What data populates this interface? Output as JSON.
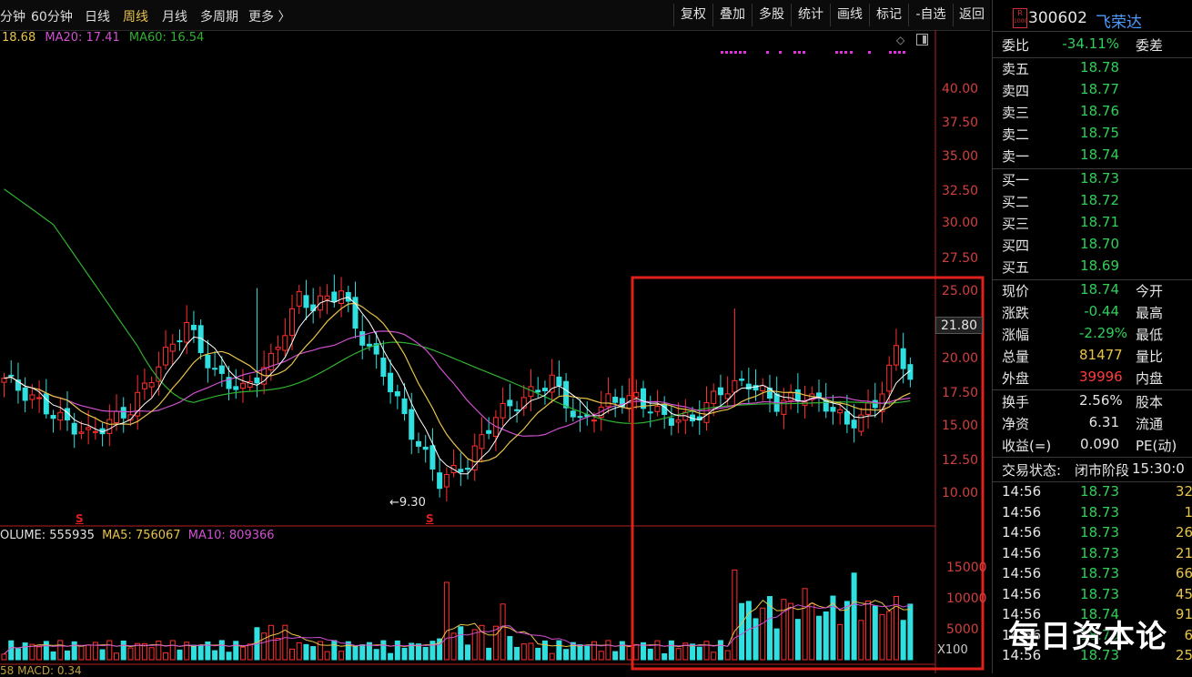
{
  "topbar": {
    "tabs": [
      "分钟",
      "60分钟",
      "日线",
      "周线",
      "月线",
      "多周期",
      "更多 〉"
    ],
    "active_tab": "周线",
    "tools": [
      "复权",
      "叠加",
      "多股",
      "统计",
      "画线",
      "标记",
      "-自选",
      "返回"
    ]
  },
  "ma_legend": {
    "ma10": "18.68",
    "ma20": "MA20: 17.41",
    "ma60": "MA60: 16.54",
    "colors": {
      "ma5": "#ffffff",
      "ma10": "#e8c34a",
      "ma20": "#d050d0",
      "ma60": "#30b030"
    }
  },
  "price_axis": [
    "40.00",
    "37.50",
    "35.00",
    "32.50",
    "30.00",
    "27.50",
    "25.00",
    "22.50",
    "20.00",
    "17.50",
    "15.00",
    "12.50",
    "10.00"
  ],
  "current_price_marker": "21.80",
  "low_marker": "←9.30",
  "s_markers": [
    "S",
    "S"
  ],
  "volume_legend": {
    "volume": "OLUME: 555935",
    "ma5": "MA5: 756067",
    "ma10": "MA10: 809366"
  },
  "volume_axis": [
    "15000",
    "10000",
    "5000"
  ],
  "volume_unit": "X100",
  "macd_legend": "58  MACD: 0.34",
  "watermark": "每日资本论",
  "stock": {
    "r_badge_top": "R",
    "r_badge_bottom": "1000",
    "code": "300602",
    "name": "飞荣达"
  },
  "weibi": {
    "label": "委比",
    "value": "-34.11%",
    "label2": "委差"
  },
  "sell_orders": [
    {
      "label": "卖五",
      "price": "18.78"
    },
    {
      "label": "卖四",
      "price": "18.77"
    },
    {
      "label": "卖三",
      "price": "18.76"
    },
    {
      "label": "卖二",
      "price": "18.75"
    },
    {
      "label": "卖一",
      "price": "18.74"
    }
  ],
  "buy_orders": [
    {
      "label": "买一",
      "price": "18.73"
    },
    {
      "label": "买二",
      "price": "18.72"
    },
    {
      "label": "买三",
      "price": "18.71"
    },
    {
      "label": "买四",
      "price": "18.70"
    },
    {
      "label": "买五",
      "price": "18.69"
    }
  ],
  "quote": [
    {
      "label": "现价",
      "value": "18.74",
      "label2": "今开",
      "color": "#2fd05a"
    },
    {
      "label": "涨跌",
      "value": "-0.44",
      "label2": "最高",
      "color": "#2fd05a"
    },
    {
      "label": "涨幅",
      "value": "-2.29%",
      "label2": "最低",
      "color": "#2fd05a"
    },
    {
      "label": "总量",
      "value": "81477",
      "label2": "量比",
      "color": "#e8c34a"
    },
    {
      "label": "外盘",
      "value": "39996",
      "label2": "内盘",
      "color": "#ff3b3b"
    }
  ],
  "fundamentals": [
    {
      "label": "换手",
      "value": "2.56%",
      "label2": "股本"
    },
    {
      "label": "净资",
      "value": "6.31",
      "label2": "流通"
    },
    {
      "label": "收益(=)",
      "value": "0.090",
      "label2": "PE(动)"
    }
  ],
  "trade_status": {
    "label": "交易状态:",
    "value": "闭市阶段",
    "time": "15:30:0"
  },
  "ticks": [
    {
      "time": "14:56",
      "price": "18.73",
      "vol": "32",
      "color": "#2fd05a"
    },
    {
      "time": "14:56",
      "price": "18.73",
      "vol": "1",
      "color": "#2fd05a"
    },
    {
      "time": "14:56",
      "price": "18.73",
      "vol": "26",
      "color": "#2fd05a"
    },
    {
      "time": "14:56",
      "price": "18.73",
      "vol": "21",
      "color": "#2fd05a"
    },
    {
      "time": "14:56",
      "price": "18.73",
      "vol": "66",
      "color": "#2fd05a"
    },
    {
      "time": "14:56",
      "price": "18.73",
      "vol": "45",
      "color": "#2fd05a"
    },
    {
      "time": "14:56",
      "price": "18.74",
      "vol": "91",
      "color": "#2fd05a"
    },
    {
      "time": "14:56",
      "price": "18.73",
      "vol": "6",
      "color": "#2fd05a"
    },
    {
      "time": "14:56",
      "price": "18.73",
      "vol": "25",
      "color": "#2fd05a"
    }
  ]
}
